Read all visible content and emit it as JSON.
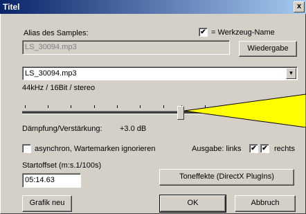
{
  "window": {
    "title": "Titel",
    "close_glyph": "x"
  },
  "alias": {
    "label": "Alias des Samples:",
    "value": "LS_30094.mp3",
    "tool_name_checked": true,
    "tool_name_label": "= Werkzeug-Name",
    "play_button": "Wiedergabe"
  },
  "file": {
    "selected": "LS_30094.mp3",
    "format": "44kHz / 16Bit / stereo"
  },
  "gain": {
    "label": "Dämpfung/Verstärkung:",
    "value": "+3.0 dB",
    "level_db": 3.0,
    "curve_color": "#ffff00"
  },
  "options": {
    "async_label": "asynchron, Wartemarken ignorieren",
    "async_checked": false,
    "output_label": "Ausgabe: links",
    "left_checked": true,
    "right_checked": true,
    "right_label": "rechts"
  },
  "start": {
    "label": "Startoffset (m:s.1/100s)",
    "value": "05:14.63"
  },
  "buttons": {
    "effects": "Toneffekte (DirectX PlugIns)",
    "graphic_new": "Grafik neu",
    "ok": "OK",
    "cancel": "Abbruch"
  }
}
